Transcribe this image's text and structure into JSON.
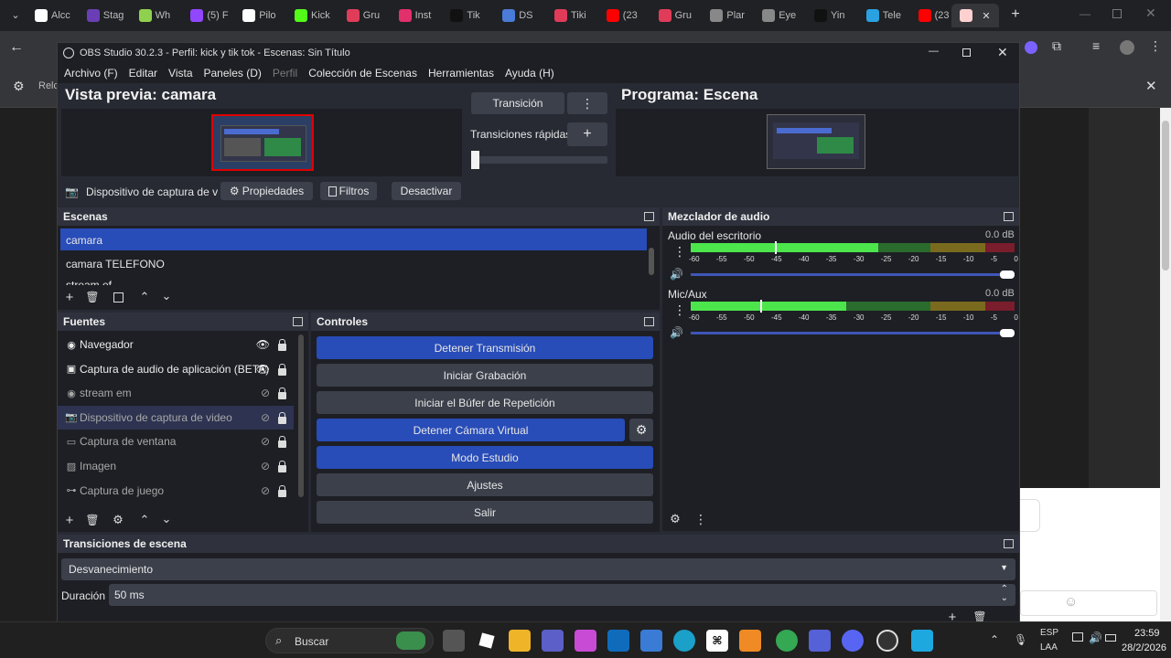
{
  "browser": {
    "tabs": [
      {
        "label": "Alcc",
        "color": "#ffffff"
      },
      {
        "label": "Stag",
        "color": "#6a3fb5"
      },
      {
        "label": "Wh",
        "color": "#8fd14f"
      },
      {
        "label": "(5) F",
        "color": "#9146ff"
      },
      {
        "label": "Pilo",
        "color": "#ffffff"
      },
      {
        "label": "Kick",
        "color": "#53fc18"
      },
      {
        "label": "Gru",
        "color": "#e03c5a"
      },
      {
        "label": "Inst",
        "color": "#e1306c"
      },
      {
        "label": "Tik",
        "color": "#111111"
      },
      {
        "label": "DS",
        "color": "#4a7bd8"
      },
      {
        "label": "Tiki",
        "color": "#e03c5a"
      },
      {
        "label": "(23",
        "color": "#ff0000"
      },
      {
        "label": "Gru",
        "color": "#e03c5a"
      },
      {
        "label": "Plar",
        "color": "#888888"
      },
      {
        "label": "Eye",
        "color": "#888888"
      },
      {
        "label": "Yin",
        "color": "#111111"
      },
      {
        "label": "Tele",
        "color": "#2aa1e0"
      },
      {
        "label": "(23",
        "color": "#ff0000"
      }
    ],
    "bookmark_text": "Relc"
  },
  "obs": {
    "title": "OBS Studio 30.2.3 - Perfil: kick y tik tok - Escenas: Sin Título",
    "menu": [
      "Archivo (F)",
      "Editar",
      "Vista",
      "Paneles (D)",
      "Perfil",
      "Colección de Escenas",
      "Herramientas",
      "Ayuda (H)"
    ],
    "preview_label": "Vista previa: camara",
    "program_label": "Programa: Escena",
    "transition_button": "Transición",
    "quick_transitions": "Transiciones rápidas",
    "source_toolbar": {
      "source_name": "Dispositivo de captura de v",
      "properties": "Propiedades",
      "filters": "Filtros",
      "deactivate": "Desactivar"
    },
    "scenes": {
      "title": "Escenas",
      "items": [
        "camara",
        "camara TELEFONO",
        "stream ef"
      ]
    },
    "sources": {
      "title": "Fuentes",
      "items": [
        {
          "label": "Navegador",
          "icon": "globe-icon",
          "visible": true
        },
        {
          "label": "Captura de audio de aplicación (BETA)",
          "icon": "app-audio-icon",
          "visible": true
        },
        {
          "label": "stream em",
          "icon": "globe-icon",
          "visible": false
        },
        {
          "label": "Dispositivo de captura de video",
          "icon": "camera-icon",
          "visible": false
        },
        {
          "label": "Captura de ventana",
          "icon": "window-icon",
          "visible": false
        },
        {
          "label": "Imagen",
          "icon": "image-icon",
          "visible": false
        },
        {
          "label": "Captura de juego",
          "icon": "gamepad-icon",
          "visible": false
        }
      ]
    },
    "controls": {
      "title": "Controles",
      "buttons": [
        "Detener Transmisión",
        "Iniciar Grabación",
        "Iniciar el Búfer de Repetición",
        "Detener Cámara Virtual",
        "Modo Estudio",
        "Ajustes",
        "Salir"
      ]
    },
    "mixer": {
      "title": "Mezclador de audio",
      "channels": [
        {
          "name": "Audio del escritorio",
          "db": "0.0 dB",
          "level": 0.58,
          "volume": 1.0
        },
        {
          "name": "Mic/Aux",
          "db": "0.0 dB",
          "level": 0.48,
          "volume": 1.0
        }
      ],
      "ticks": [
        "-60",
        "-55",
        "-50",
        "-45",
        "-40",
        "-35",
        "-30",
        "-25",
        "-20",
        "-15",
        "-10",
        "-5",
        "0"
      ]
    },
    "transitions": {
      "title": "Transiciones de escena",
      "selected": "Desvanecimiento",
      "duration_label": "Duración",
      "duration_value": "50 ms"
    }
  },
  "taskbar": {
    "search": "Buscar",
    "lang_top": "ESP",
    "lang_bottom": "LAA",
    "time": "23:59",
    "date": "28/2/2026"
  }
}
